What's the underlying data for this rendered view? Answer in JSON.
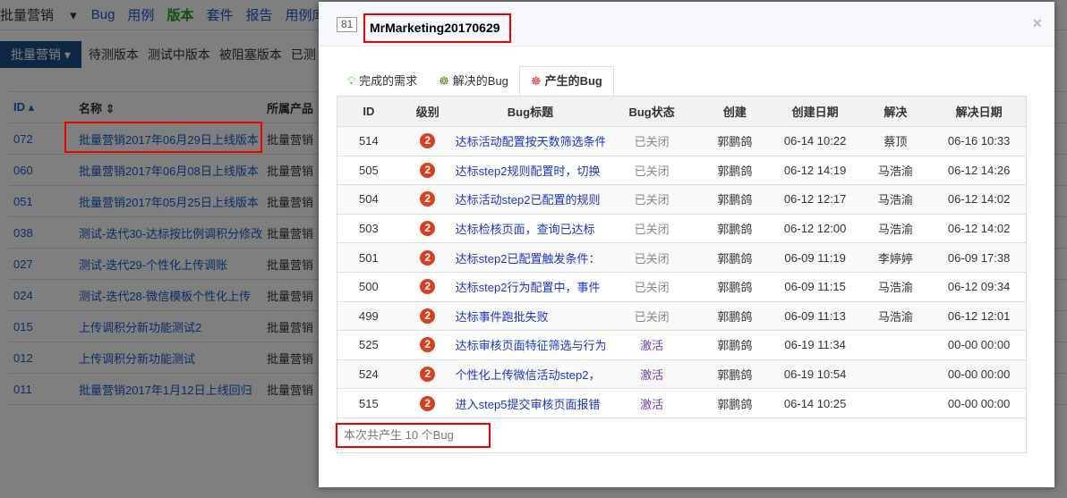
{
  "nav": {
    "product": "批量营销",
    "items": [
      "Bug",
      "用例",
      "版本",
      "套件",
      "报告",
      "用例库"
    ],
    "active": "版本"
  },
  "subnav": {
    "button": "批量营销",
    "items": [
      "待测版本",
      "测试中版本",
      "被阻塞版本",
      "已测"
    ]
  },
  "bg_table": {
    "headers": [
      "ID",
      "名称",
      "所属产品"
    ],
    "rows": [
      [
        "072",
        "批量营销2017年06月29日上线版本",
        "批量营销"
      ],
      [
        "060",
        "批量营销2017年06月08日上线版本",
        "批量营销"
      ],
      [
        "051",
        "批量营销2017年05月25日上线版本",
        "批量营销"
      ],
      [
        "038",
        "测试-迭代30-达标按比例调积分修改",
        "批量营销"
      ],
      [
        "027",
        "测试-迭代29-个性化上传调账",
        "批量营销"
      ],
      [
        "024",
        "测试-迭代28-微信模板个性化上传",
        "批量营销"
      ],
      [
        "015",
        "上传调积分新功能测试2",
        "批量营销"
      ],
      [
        "012",
        "上传调积分新功能测试",
        "批量营销"
      ],
      [
        "011",
        "批量营销2017年1月12日上线回归",
        "批量营销"
      ]
    ]
  },
  "modal": {
    "id": "81",
    "title": "MrMarketing20170629",
    "close": "×",
    "tabs": [
      "完成的需求",
      "解决的Bug",
      "产生的Bug"
    ],
    "headers": [
      "ID",
      "级别",
      "Bug标题",
      "Bug状态",
      "创建",
      "创建日期",
      "解决",
      "解决日期"
    ],
    "rows": [
      {
        "id": "514",
        "sev": "2",
        "title": "达标活动配置按天数筛选条件",
        "status": "已关闭",
        "creator": "郭鹏鸽",
        "created": "06-14 10:22",
        "resolver": "蔡顶",
        "resolved": "06-16 10:33"
      },
      {
        "id": "505",
        "sev": "2",
        "title": "达标step2规则配置时，切换",
        "status": "已关闭",
        "creator": "郭鹏鸽",
        "created": "06-12 14:19",
        "resolver": "马浩渝",
        "resolved": "06-12 14:26"
      },
      {
        "id": "504",
        "sev": "2",
        "title": "达标活动step2已配置的规则",
        "status": "已关闭",
        "creator": "郭鹏鸽",
        "created": "06-12 12:17",
        "resolver": "马浩渝",
        "resolved": "06-12 14:02"
      },
      {
        "id": "503",
        "sev": "2",
        "title": "达标检核页面，查询已达标",
        "status": "已关闭",
        "creator": "郭鹏鸽",
        "created": "06-12 12:00",
        "resolver": "马浩渝",
        "resolved": "06-12 14:02"
      },
      {
        "id": "501",
        "sev": "2",
        "title": "达标step2已配置触发条件：",
        "status": "已关闭",
        "creator": "郭鹏鸽",
        "created": "06-09 11:19",
        "resolver": "李婷婷",
        "resolved": "06-09 17:38"
      },
      {
        "id": "500",
        "sev": "2",
        "title": "达标step2行为配置中，事件",
        "status": "已关闭",
        "creator": "郭鹏鸽",
        "created": "06-09 11:15",
        "resolver": "马浩渝",
        "resolved": "06-12 09:34"
      },
      {
        "id": "499",
        "sev": "2",
        "title": "达标事件跑批失败",
        "status": "已关闭",
        "creator": "郭鹏鸽",
        "created": "06-09 11:13",
        "resolver": "马浩渝",
        "resolved": "06-12 12:01"
      },
      {
        "id": "525",
        "sev": "2",
        "title": "达标审核页面特征筛选与行为",
        "status": "激活",
        "creator": "郭鹏鸽",
        "created": "06-19 11:34",
        "resolver": "",
        "resolved": "00-00 00:00"
      },
      {
        "id": "524",
        "sev": "2",
        "title": "个性化上传微信活动step2，",
        "status": "激活",
        "creator": "郭鹏鸽",
        "created": "06-19 10:54",
        "resolver": "",
        "resolved": "00-00 00:00"
      },
      {
        "id": "515",
        "sev": "2",
        "title": "进入step5提交审核页面报错",
        "status": "激活",
        "creator": "郭鹏鸽",
        "created": "06-14 10:25",
        "resolver": "",
        "resolved": "00-00 00:00"
      }
    ],
    "summary": "本次共产生 10 个Bug"
  }
}
